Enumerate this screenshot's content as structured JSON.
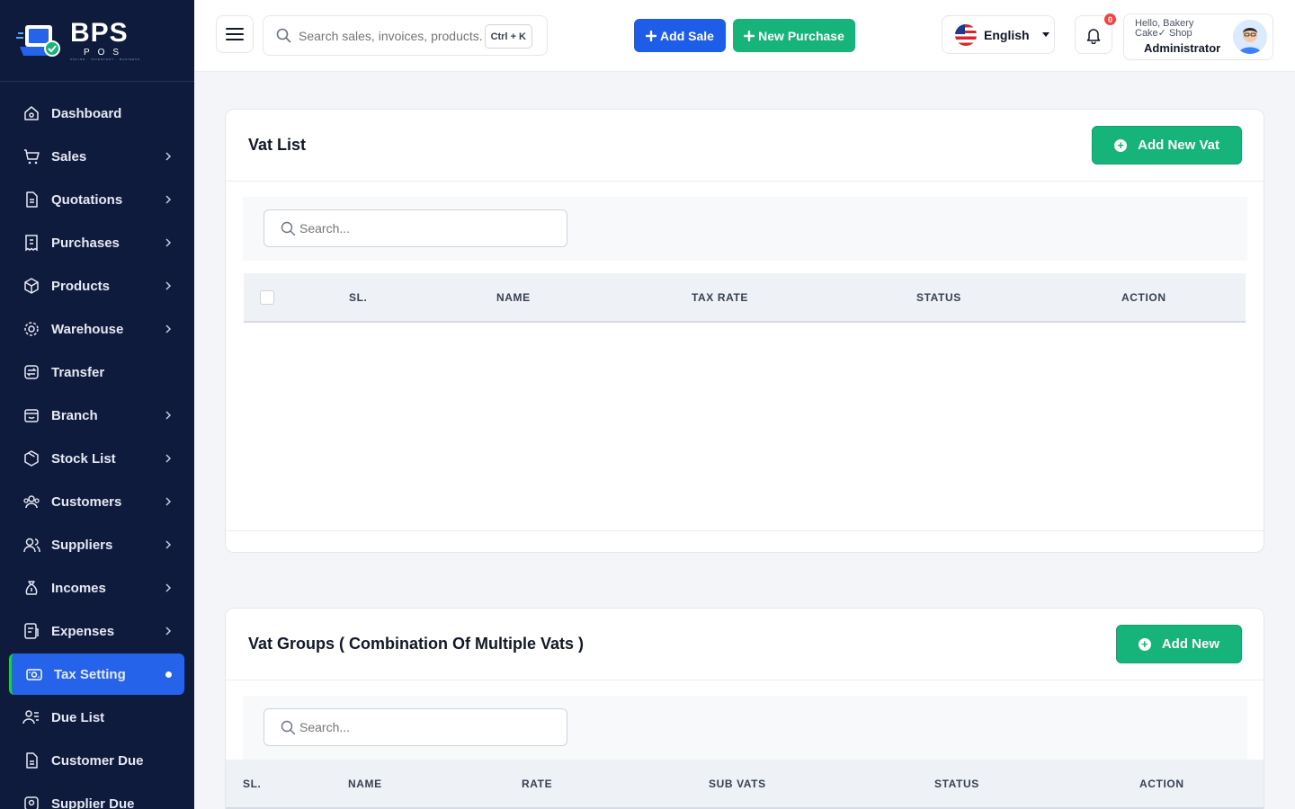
{
  "brand": {
    "name": "BPS",
    "sub": "POS",
    "tagline": "ONLINE · INVENTORY · BUSINESS"
  },
  "sidebar": {
    "items": [
      {
        "label": "Dashboard",
        "icon": "home-icon",
        "chevron": false
      },
      {
        "label": "Sales",
        "icon": "cart-icon",
        "chevron": true
      },
      {
        "label": "Quotations",
        "icon": "document-icon",
        "chevron": true
      },
      {
        "label": "Purchases",
        "icon": "receipt-icon",
        "chevron": true
      },
      {
        "label": "Products",
        "icon": "box-icon",
        "chevron": true
      },
      {
        "label": "Warehouse",
        "icon": "warehouse-icon",
        "chevron": true
      },
      {
        "label": "Transfer",
        "icon": "transfer-icon",
        "chevron": false
      },
      {
        "label": "Branch",
        "icon": "store-icon",
        "chevron": true
      },
      {
        "label": "Stock List",
        "icon": "package-icon",
        "chevron": true
      },
      {
        "label": "Customers",
        "icon": "users-icon",
        "chevron": true
      },
      {
        "label": "Suppliers",
        "icon": "suppliers-icon",
        "chevron": true
      },
      {
        "label": "Incomes",
        "icon": "money-bag-icon",
        "chevron": true
      },
      {
        "label": "Expenses",
        "icon": "expense-icon",
        "chevron": true
      },
      {
        "label": "Tax Setting",
        "icon": "tax-icon",
        "chevron": false,
        "active": true
      },
      {
        "label": "Due List",
        "icon": "due-list-icon",
        "chevron": false
      },
      {
        "label": "Customer Due",
        "icon": "customer-due-icon",
        "chevron": false
      },
      {
        "label": "Supplier Due",
        "icon": "supplier-due-icon",
        "chevron": false
      }
    ]
  },
  "header": {
    "search_placeholder": "Search sales, invoices, products...",
    "shortcut": "Ctrl + K",
    "add_sale": "Add Sale",
    "new_purchase": "New Purchase",
    "language": "English",
    "notification_count": "0",
    "greeting": "Hello, Bakery Cake✓ Shop",
    "role": "Administrator"
  },
  "vat_list": {
    "title": "Vat List",
    "add_button": "Add New Vat",
    "search_placeholder": "Search...",
    "columns": [
      "SL.",
      "NAME",
      "TAX RATE",
      "STATUS",
      "ACTION"
    ],
    "rows": []
  },
  "vat_groups": {
    "title": "Vat Groups ( Combination Of Multiple Vats )",
    "add_button": "Add New",
    "search_placeholder": "Search...",
    "columns": [
      "SL.",
      "NAME",
      "RATE",
      "SUB VATS",
      "STATUS",
      "ACTION"
    ],
    "rows": []
  },
  "colors": {
    "sidebar_bg": "#0f1b3d",
    "primary": "#1d5de8",
    "success": "#16b37a",
    "active_nav": "#2563eb"
  }
}
